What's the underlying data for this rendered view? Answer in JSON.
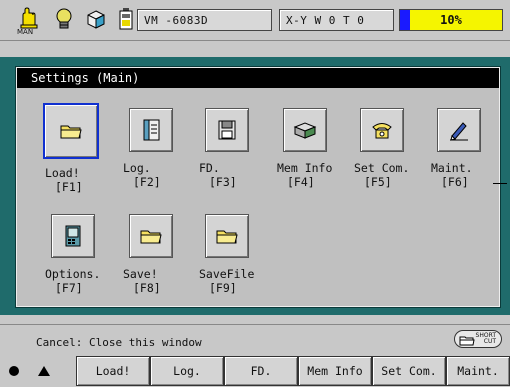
{
  "topbar": {
    "hand_label": "MAN",
    "vm_text": "VM  -6083D",
    "xy_text": "X-Y   W 0 T 0",
    "progress_text": "10%",
    "progress_fraction": 0.1,
    "colors": {
      "progress_bg": "#f5f500",
      "progress_bar": "#1a1aff"
    }
  },
  "dialog": {
    "title": "Settings (Main)",
    "items": [
      {
        "name": "Load!",
        "key": "[F1]",
        "icon": "folder-icon"
      },
      {
        "name": "Log.",
        "key": "[F2]",
        "icon": "notebook-icon"
      },
      {
        "name": "FD.",
        "key": "[F3]",
        "icon": "floppy-icon"
      },
      {
        "name": "Mem Info",
        "key": "[F4]",
        "icon": "memory-box-icon"
      },
      {
        "name": "Set Com.",
        "key": "[F5]",
        "icon": "phone-icon"
      },
      {
        "name": "Maint.",
        "key": "[F6]",
        "icon": "pen-icon"
      },
      {
        "name": "Options.",
        "key": "[F7]",
        "icon": "device-icon"
      },
      {
        "name": "Save!",
        "key": "[F8]",
        "icon": "folder-icon"
      },
      {
        "name": "SaveFile",
        "key": "[F9]",
        "icon": "folder-icon"
      }
    ]
  },
  "footer": {
    "hint": "Cancel: Close this window",
    "shortcut_top": "SHORT",
    "shortcut_bottom": "CUT",
    "fkeys": [
      "Load!",
      "Log.",
      "FD.",
      "Mem Info",
      "Set Com.",
      "Maint."
    ]
  }
}
